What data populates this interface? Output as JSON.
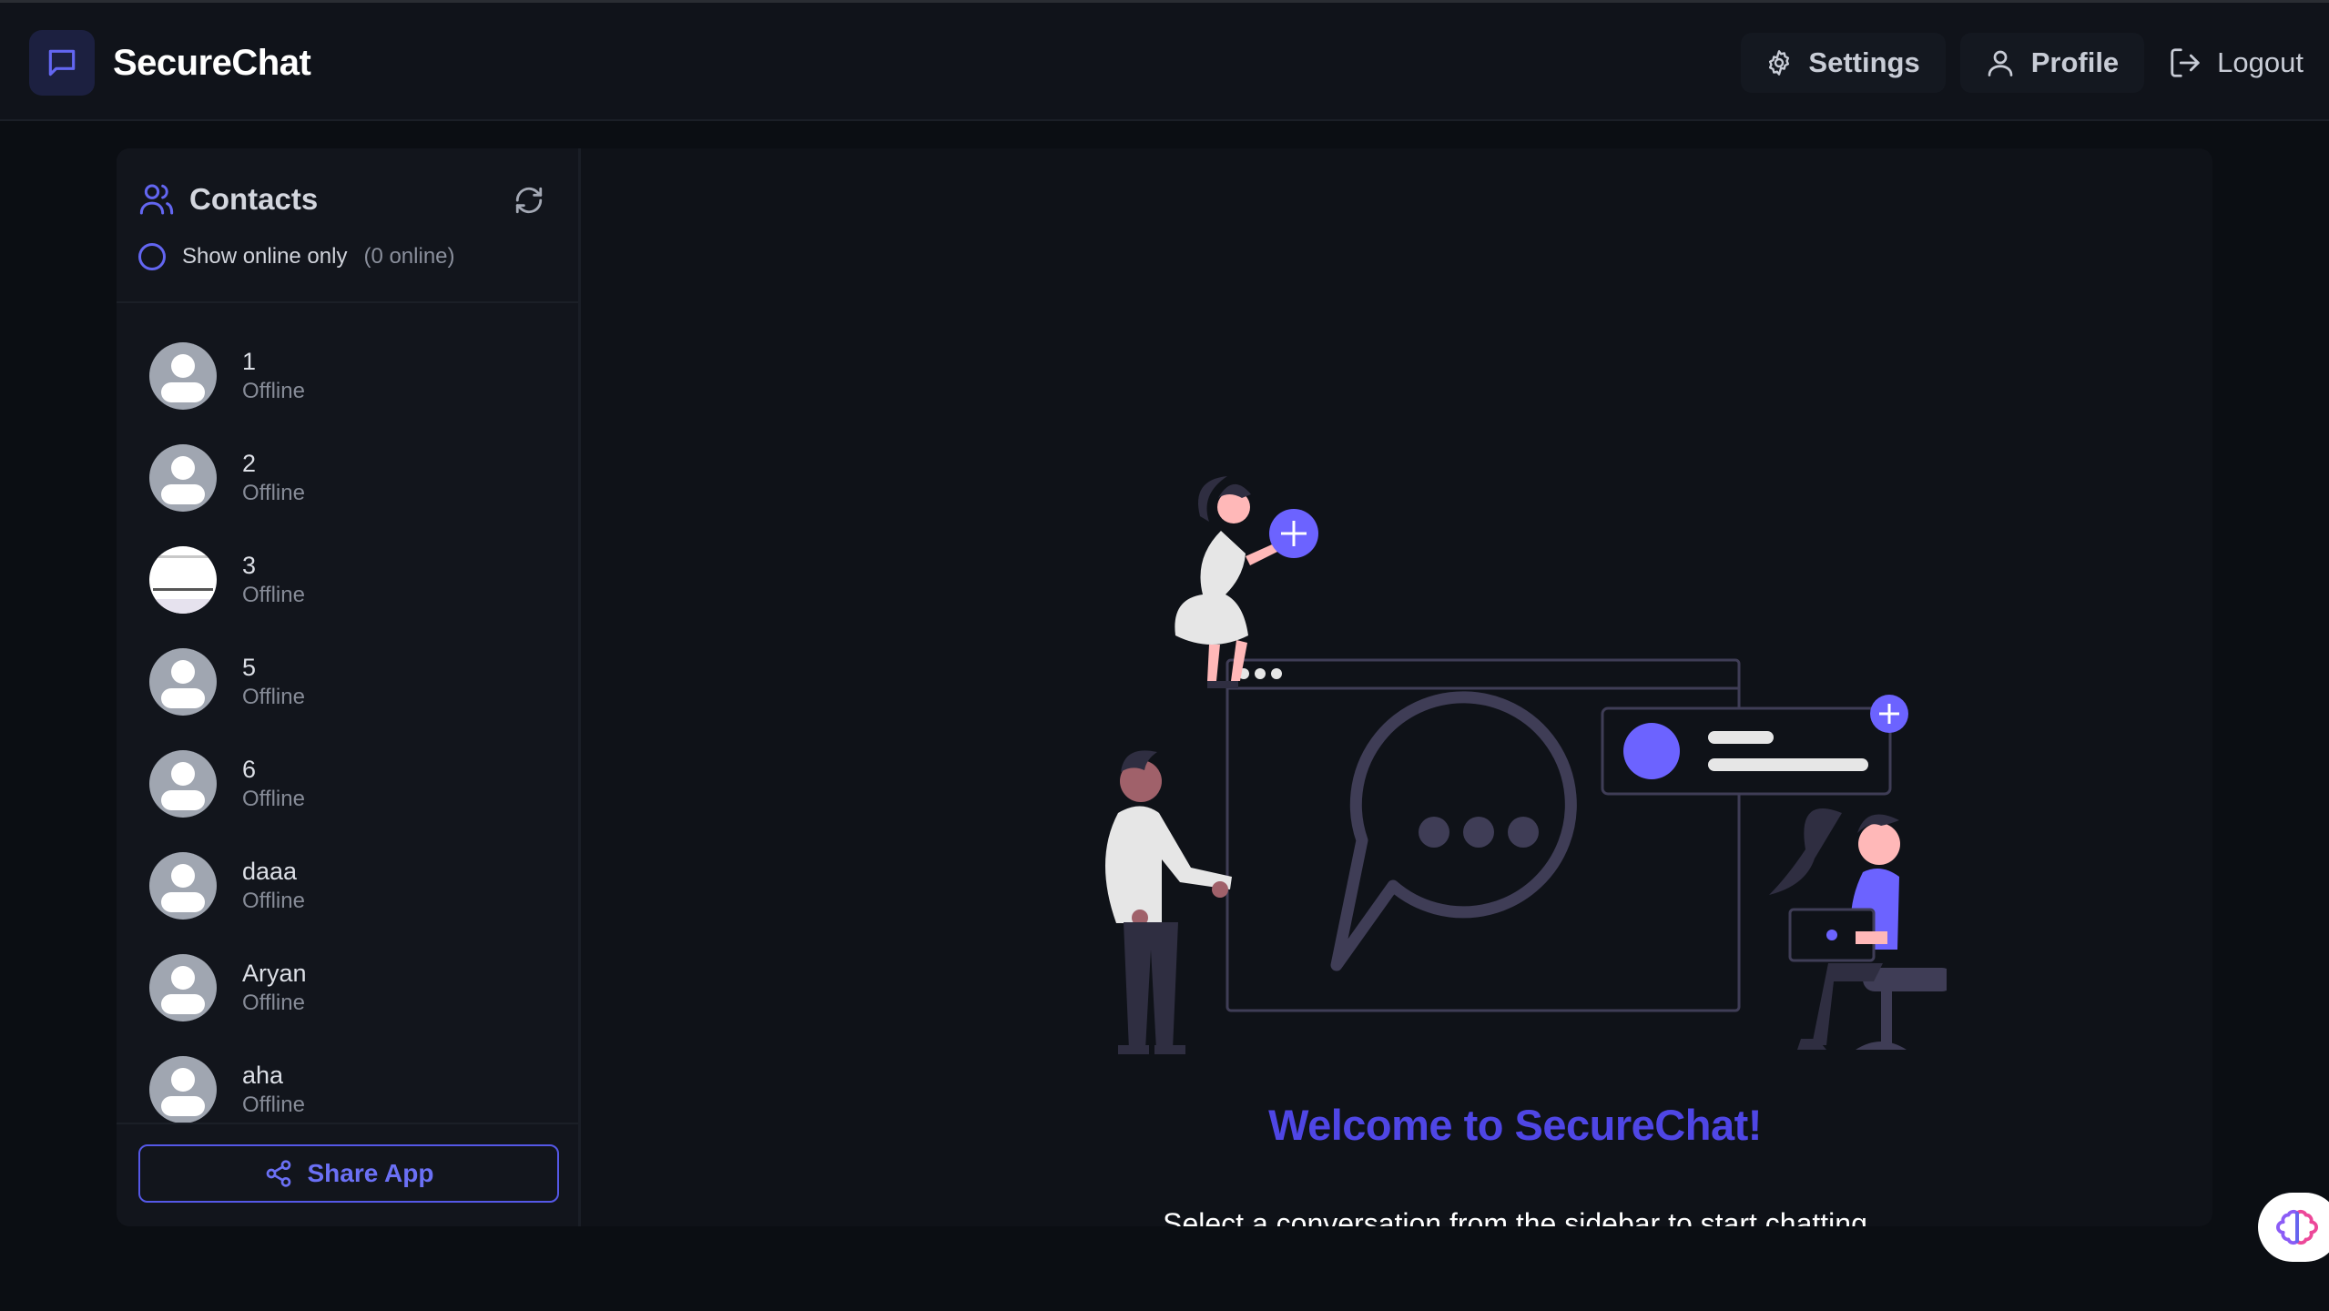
{
  "app": {
    "name": "SecureChat"
  },
  "nav": {
    "settings_label": "Settings",
    "profile_label": "Profile",
    "logout_label": "Logout"
  },
  "sidebar": {
    "title": "Contacts",
    "online_only_label": "Show online only",
    "online_count": "(0 online)",
    "contacts": [
      {
        "name": "1",
        "status": "Offline",
        "avatar": "default-avatar"
      },
      {
        "name": "2",
        "status": "Offline",
        "avatar": "default-avatar"
      },
      {
        "name": "3",
        "status": "Offline",
        "avatar": "photo-avatar"
      },
      {
        "name": "5",
        "status": "Offline",
        "avatar": "default-avatar"
      },
      {
        "name": "6",
        "status": "Offline",
        "avatar": "default-avatar"
      },
      {
        "name": "daaa",
        "status": "Offline",
        "avatar": "default-avatar"
      },
      {
        "name": "Aryan",
        "status": "Offline",
        "avatar": "default-avatar"
      },
      {
        "name": "aha",
        "status": "Offline",
        "avatar": "default-avatar"
      }
    ],
    "share_label": "Share App"
  },
  "welcome": {
    "title": "Welcome to SecureChat!",
    "subtitle": "Select a conversation from the sidebar to start chatting"
  },
  "colors": {
    "accent": "#4f46e5",
    "accent_light": "#6366f1",
    "background": "#0b0e13",
    "panel": "#12151c",
    "illustration_purple": "#6c63ff"
  }
}
